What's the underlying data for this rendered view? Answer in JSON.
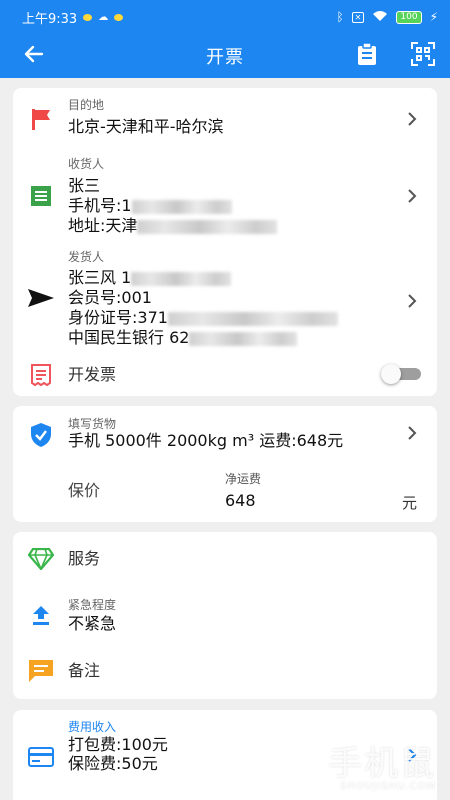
{
  "status_bar": {
    "time": "上午9:33",
    "battery": "100"
  },
  "app_bar": {
    "title": "开票",
    "back_icon": "back-arrow-icon",
    "action_icons": [
      "clipboard-icon",
      "qr-scan-icon"
    ]
  },
  "route": {
    "label": "目的地",
    "value": "北京-天津和平-哈尔滨"
  },
  "receiver": {
    "label": "收货人",
    "name": "张三",
    "phone_prefix": "手机号:1",
    "address_prefix": "地址:天津"
  },
  "sender": {
    "label": "发货人",
    "name_prefix": "张三风 1",
    "member": "会员号:001",
    "id_prefix": "身份证号:371",
    "bank_prefix": "中国民生银行 62"
  },
  "invoice": {
    "label": "开发票",
    "enabled": false
  },
  "goods": {
    "label": "填写货物",
    "summary": "手机 5000件 2000kg m³ 运费:648元"
  },
  "insurance": {
    "label": "保价",
    "net_freight_label": "净运费",
    "net_freight_value": "648",
    "unit": "元"
  },
  "options": {
    "service_label": "服务",
    "urgency_label": "紧急程度",
    "urgency_value": "不紧急",
    "remark_label": "备注"
  },
  "fees": {
    "label": "费用收入",
    "packing": "打包费:100元",
    "insurance_fee": "保险费:50元"
  },
  "watermark": {
    "text": "手机鼠",
    "sub": "SHOUJISHU.COM"
  },
  "colors": {
    "primary": "#1d86f0",
    "flag_red": "#f04747",
    "receiver_green": "#3aa34a",
    "invoice_red": "#f0555b",
    "shield_blue": "#1d86f0",
    "diamond_green": "#39b54a",
    "upload_blue": "#1d86f0",
    "note_orange": "#f5a321",
    "card_blue": "#1d86f0"
  }
}
